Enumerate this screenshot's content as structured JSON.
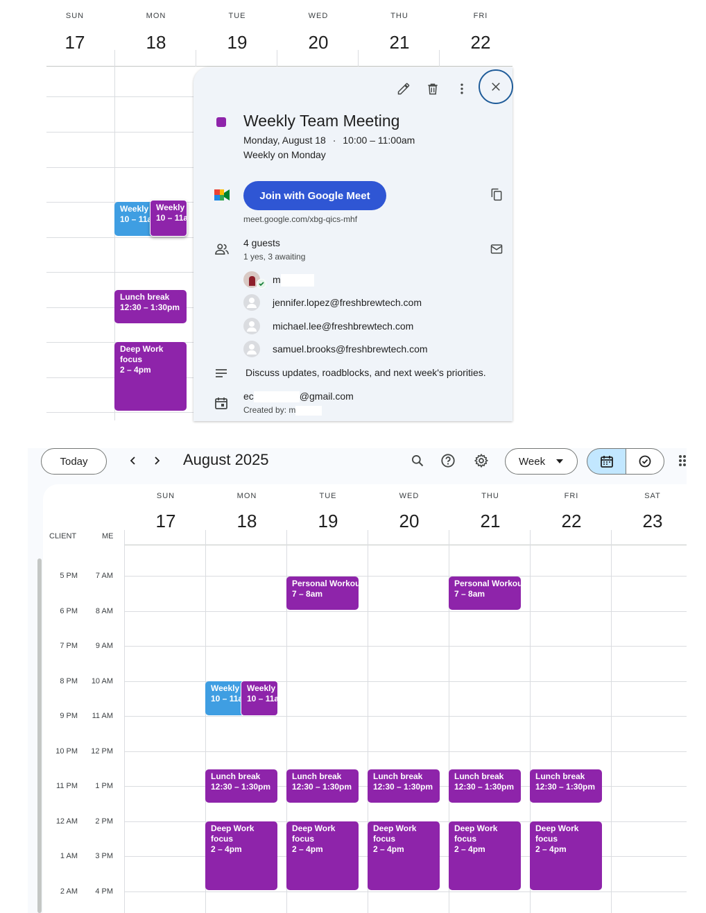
{
  "top": {
    "days": [
      {
        "name": "SUN",
        "num": "17"
      },
      {
        "name": "MON",
        "num": "18"
      },
      {
        "name": "TUE",
        "num": "19"
      },
      {
        "name": "WED",
        "num": "20"
      },
      {
        "name": "THU",
        "num": "21"
      },
      {
        "name": "FRI",
        "num": "22"
      }
    ],
    "events": {
      "weekly_a": {
        "title": "Weekly",
        "time": "10 – 11a"
      },
      "weekly_b": {
        "title": "Weekly",
        "time": "10 – 11a"
      },
      "lunch": {
        "title": "Lunch break",
        "time": "12:30 – 1:30pm"
      },
      "deep": {
        "title": "Deep Work focus",
        "time": "2 – 4pm"
      }
    }
  },
  "popover": {
    "title": "Weekly Team Meeting",
    "date": "Monday, August 18",
    "time": "10:00 – 11:00am",
    "recurrence": "Weekly on Monday",
    "meet_button": "Join with Google Meet",
    "meet_link": "meet.google.com/xbg-qics-mhf",
    "guests_count": "4 guests",
    "guests_status": "1 yes, 3 awaiting",
    "guests": [
      "m",
      "jennifer.lopez@freshbrewtech.com",
      "michael.lee@freshbrewtech.com",
      "samuel.brooks@freshbrewtech.com"
    ],
    "description": "Discuss updates, roadblocks, and next week's priorities.",
    "calendar_owner_prefix": "ec",
    "calendar_owner_suffix": "@gmail.com",
    "created_by": "Created by: m",
    "color": "#8e24aa"
  },
  "toolbar": {
    "today": "Today",
    "month": "August 2025",
    "view": "Week"
  },
  "bottom": {
    "days": [
      {
        "name": "SUN",
        "num": "17"
      },
      {
        "name": "MON",
        "num": "18"
      },
      {
        "name": "TUE",
        "num": "19"
      },
      {
        "name": "WED",
        "num": "20"
      },
      {
        "name": "THU",
        "num": "21"
      },
      {
        "name": "FRI",
        "num": "22"
      },
      {
        "name": "SAT",
        "num": "23"
      }
    ],
    "tz_client": "CLIENT",
    "tz_me": "ME",
    "client_times": [
      "5 PM",
      "6 PM",
      "7 PM",
      "8 PM",
      "9 PM",
      "10 PM",
      "11 PM",
      "12 AM",
      "1 AM",
      "2 AM"
    ],
    "me_times": [
      "7 AM",
      "8 AM",
      "9 AM",
      "10 AM",
      "11 AM",
      "12 PM",
      "1 PM",
      "2 PM",
      "3 PM",
      "4 PM"
    ],
    "events": {
      "workout": {
        "title": "Personal Workout",
        "time": "7 – 8am"
      },
      "weekly": {
        "title": "Weekly",
        "time": "10 – 11a"
      },
      "lunch": {
        "title": "Lunch break",
        "time": "12:30 – 1:30pm"
      },
      "deep": {
        "title": "Deep Work focus",
        "time": "2 – 4pm"
      }
    }
  }
}
